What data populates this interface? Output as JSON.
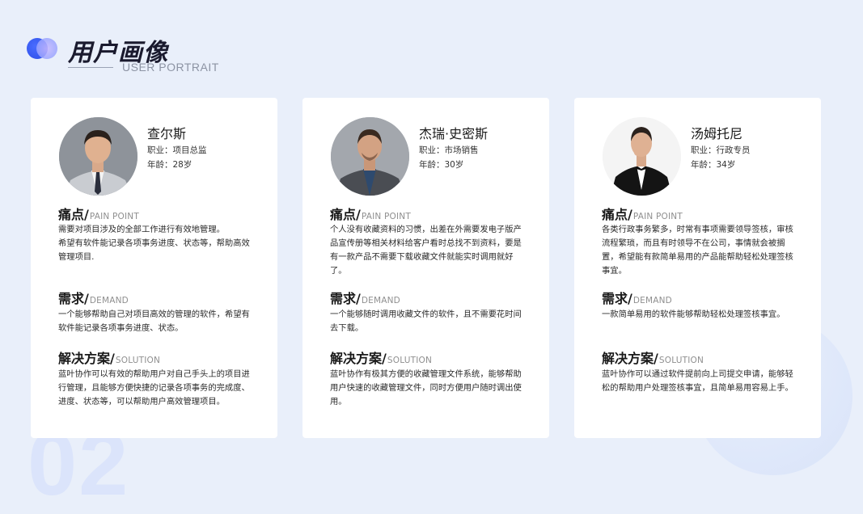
{
  "header": {
    "title": "用户画像",
    "subtitle": "USER PORTRAIT",
    "bg_number": "02"
  },
  "cards": [
    {
      "name": "查尔斯",
      "job": "职业：项目总监",
      "age": "年龄：28岁",
      "avatar_icon": "person-suit-icon",
      "pain_title": "痛点/",
      "pain_en": "PAIN POINT",
      "pain_text": "需要对项目涉及的全部工作进行有效地管理。\n希望有软件能记录各项事务进度、状态等，帮助高效管理项目.",
      "demand_title": "需求/",
      "demand_en": "DEMAND",
      "demand_text": "一个能够帮助自己对项目高效的管理的软件，希望有软件能记录各项事务进度、状态。",
      "solution_title": "解决方案/",
      "solution_en": "SOLUTION",
      "solution_text": "蓝叶协作可以有效的帮助用户对自己手头上的项目进行管理，且能够方便快捷的记录各项事务的完成度、进度、状态等，可以帮助用户高效管理项目。"
    },
    {
      "name": "杰瑞·史密斯",
      "job": "职业：市场销售",
      "age": "年龄：30岁",
      "avatar_icon": "person-blazer-icon",
      "pain_title": "痛点/",
      "pain_en": "PAIN POINT",
      "pain_text": "个人没有收藏资料的习惯，出差在外需要发电子版产品宣传册等相关材料给客户看时总找不到资料，要是有一款产品不需要下载收藏文件就能实时调用就好了。",
      "demand_title": "需求/",
      "demand_en": "DEMAND",
      "demand_text": "一个能够随时调用收藏文件的软件，且不需要花时间去下载。",
      "solution_title": "解决方案/",
      "solution_en": "SOLUTION",
      "solution_text": "蓝叶协作有极其方便的收藏管理文件系统，能够帮助用户快速的收藏管理文件，同时方便用户随时调出使用。"
    },
    {
      "name": "汤姆托尼",
      "job": "职业：行政专员",
      "age": "年龄：34岁",
      "avatar_icon": "person-tuxedo-icon",
      "pain_title": "痛点/",
      "pain_en": "PAIN POINT",
      "pain_text": "各类行政事务繁多，时常有事项需要领导签核，审核流程繁琐，而且有时领导不在公司，事情就会被搁置，希望能有款简单易用的产品能帮助轻松处理签核事宜。",
      "demand_title": "需求/",
      "demand_en": "DEMAND",
      "demand_text": "一款简单易用的软件能够帮助轻松处理签核事宜。",
      "solution_title": "解决方案/",
      "solution_en": "SOLUTION",
      "solution_text": "蓝叶协作可以通过软件提前向上司提交申请，能够轻松的帮助用户处理签核事宜，且简单易用容易上手。"
    }
  ]
}
